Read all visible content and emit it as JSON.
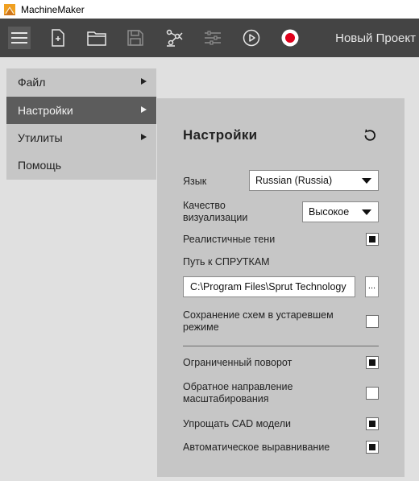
{
  "window": {
    "title": "MachineMaker"
  },
  "toolbar": {
    "buttons": [
      {
        "icon": "menu-icon",
        "active": true
      },
      {
        "icon": "new-file-icon"
      },
      {
        "icon": "open-folder-icon"
      },
      {
        "icon": "save-icon",
        "disabled": true
      },
      {
        "icon": "robot-arm-icon"
      },
      {
        "icon": "sliders-icon",
        "disabled": true
      },
      {
        "icon": "play-icon"
      },
      {
        "icon": "record-icon"
      }
    ],
    "project_name": "Новый Проект"
  },
  "menu": {
    "items": [
      {
        "label": "Файл",
        "submenu": true
      },
      {
        "label": "Настройки",
        "submenu": true,
        "selected": true
      },
      {
        "label": "Утилиты",
        "submenu": true
      },
      {
        "label": "Помощь",
        "submenu": false
      }
    ]
  },
  "settings": {
    "title": "Настройки",
    "language": {
      "label": "Язык",
      "value": "Russian (Russia)"
    },
    "quality": {
      "label_line1": "Качество",
      "label_line2": "визуализации",
      "value": "Высокое"
    },
    "shadows": {
      "label": "Реалистичные тени",
      "checked": true
    },
    "path": {
      "label": "Путь к СПРУТКАМ",
      "value": "C:\\Program Files\\Sprut Technology",
      "browse_label": "..."
    },
    "legacy_save": {
      "label_line1": "Сохранение схем в устаревшем",
      "label_line2": "режиме",
      "checked": false
    },
    "limited_rotation": {
      "label": "Ограниченный поворот",
      "checked": true
    },
    "reverse_zoom": {
      "label_line1": "Обратное направление",
      "label_line2": "масштабирования",
      "checked": false
    },
    "simplify_cad": {
      "label": "Упрощать CAD модели",
      "checked": true
    },
    "auto_align": {
      "label": "Автоматическое выравнивание",
      "checked": true
    }
  },
  "colors": {
    "toolbar_bg": "#444444",
    "menu_bg": "#c6c6c6",
    "menu_selected_bg": "#5c5c5c",
    "record_red": "#e0001b",
    "app_background": "#e0e0e0"
  }
}
